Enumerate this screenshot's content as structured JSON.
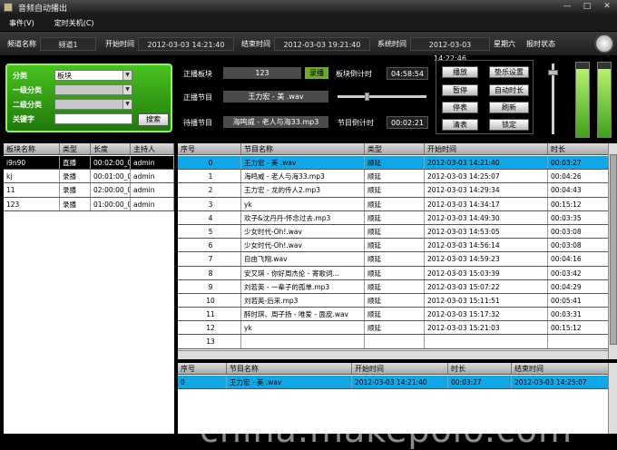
{
  "window": {
    "title": "音频自动播出",
    "min": "—",
    "max": "□",
    "close": "✕"
  },
  "menu": [
    "事件(V)",
    "定时关机(C)"
  ],
  "info": {
    "channel_label": "频道名称",
    "channel_value": "频道1",
    "start_label": "开始时间",
    "start_value": "2012-03-03 14:21:40",
    "end_label": "结束时间",
    "end_value": "2012-03-03 19:21:40",
    "sys_label": "系统时间",
    "sys_value": "2012-03-03 14:22:46",
    "weekday": "星期六",
    "clock_status": "报时状态"
  },
  "filter": {
    "category_label": "分类",
    "category_value": "板块",
    "level1_label": "一级分类",
    "level1_value": "",
    "level2_label": "二级分类",
    "level2_value": "",
    "keyword_label": "关键字",
    "keyword_value": "",
    "search": "搜索"
  },
  "play": {
    "board_label": "正播板块",
    "board_value": "123",
    "board_type": "录播",
    "board_countdown_label": "板块倒计时",
    "board_countdown": "04:58:54",
    "program_label": "正播节目",
    "program_value": "王力宏 - 美 .wav",
    "pending_label": "待播节目",
    "pending_value": "海鸣威 - 老人与海33.mp3",
    "program_countdown_label": "节目倒计时",
    "program_countdown": "00:02:21",
    "progress": 0.32
  },
  "controls": {
    "play": "播放",
    "pause": "暂停",
    "stop": "停表",
    "clear": "清表",
    "bgm": "垫乐设置",
    "autoext": "自动时长",
    "refresh": "刷新",
    "lock": "锁定"
  },
  "meters": {
    "left": 0.92,
    "right": 0.92,
    "volume": 0.9
  },
  "board_table": {
    "headers": [
      "板块名称",
      "类型",
      "长度",
      "主持人"
    ],
    "rows": [
      [
        "i9n90",
        "直播",
        "00:02:00_0",
        "admin"
      ],
      [
        "kj",
        "录播",
        "00:01:00_0",
        "admin"
      ],
      [
        "11",
        "录播",
        "02:00:00_0",
        "admin"
      ],
      [
        "123",
        "录播",
        "01:00:00_0",
        "admin"
      ]
    ]
  },
  "playlist": {
    "headers": [
      "序号",
      "节目名称",
      "类型",
      "开始时间",
      "时长"
    ],
    "rows": [
      [
        "0",
        "王力宏 - 美 .wav",
        "顺延",
        "2012-03-03 14:21:40",
        "00:03:27"
      ],
      [
        "1",
        "海鸣威 - 老人与海33.mp3",
        "顺延",
        "2012-03-03 14:25:07",
        "00:04:26"
      ],
      [
        "2",
        "王力宏 - 龙的传人2.mp3",
        "顺延",
        "2012-03-03 14:29:34",
        "00:04:43"
      ],
      [
        "3",
        "yk",
        "顺延",
        "2012-03-03 14:34:17",
        "00:15:12"
      ],
      [
        "4",
        "欢子&沈丹丹-怀念过去.mp3",
        "顺延",
        "2012-03-03 14:49:30",
        "00:03:35"
      ],
      [
        "5",
        "少女时代-Oh!.wav",
        "顺延",
        "2012-03-03 14:53:05",
        "00:03:08"
      ],
      [
        "6",
        "少女时代-Oh!.wav",
        "顺延",
        "2012-03-03 14:56:14",
        "00:03:08"
      ],
      [
        "7",
        "自由飞翔.wav",
        "顺延",
        "2012-03-03 14:59:23",
        "00:04:16"
      ],
      [
        "8",
        "安又琪 - 你好周杰伦 - 寄歌词...",
        "顺延",
        "2012-03-03 15:03:39",
        "00:03:42"
      ],
      [
        "9",
        "刘若英 - 一辈子的孤单.mp3",
        "顺延",
        "2012-03-03 15:07:22",
        "00:04:29"
      ],
      [
        "10",
        "刘若英-后来.mp3",
        "顺延",
        "2012-03-03 15:11:51",
        "00:05:41"
      ],
      [
        "11",
        "醉时琪、周子扬 - 唯爱 - 面皮.wav",
        "顺延",
        "2012-03-03 15:17:32",
        "00:03:31"
      ],
      [
        "12",
        "yk",
        "顺延",
        "2012-03-03 15:21:03",
        "00:15:12"
      ],
      [
        "13",
        "",
        "",
        "",
        ""
      ]
    ]
  },
  "history": {
    "headers": [
      "序号",
      "节目名称",
      "开始时间",
      "时长",
      "结束时间"
    ],
    "rows": [
      [
        "0",
        "王力宏 - 美 .wav",
        "2012-03-03 14:21:40",
        "00:03:27",
        "2012-03-03 14:25:07"
      ]
    ]
  },
  "watermark": "china.makepolo.com"
}
